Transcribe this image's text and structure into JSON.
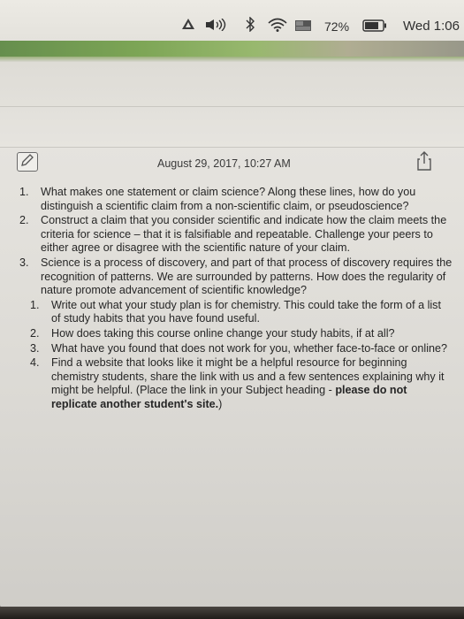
{
  "status_bar": {
    "battery_percent": "72%",
    "clock": "Wed 1:06"
  },
  "note": {
    "timestamp": "August 29, 2017, 10:27 AM",
    "list_a": [
      {
        "num": "1.",
        "text": "What makes one statement or claim science? Along these lines, how do you distinguish a scientific claim from a non-scientific claim, or pseudoscience?"
      },
      {
        "num": "2.",
        "text": "Construct a claim that you consider scientific and indicate how the claim meets the criteria for science – that it is falsifiable and repeatable. Challenge your peers to either agree or disagree with the scientific nature of your claim."
      },
      {
        "num": "3.",
        "text": "Science is a process of discovery, and part of that process of discovery requires the recognition of patterns. We are surrounded by patterns. How does the regularity of nature promote advancement of scientific knowledge?"
      }
    ],
    "list_b": [
      {
        "num": "1.",
        "text": "Write out what your study plan is for chemistry. This could take the form of a list of study habits that you have found useful."
      },
      {
        "num": "2.",
        "text": "How does taking this course online change your study habits, if at all?"
      },
      {
        "num": "3.",
        "text": "What have you found that does not work for you, whether face-to-face or online?"
      },
      {
        "num": "4.",
        "text": "Find a website that looks like it might be a helpful resource for beginning chemistry students, share the link with us and a few sentences explaining why it might be helpful. (Place the link in your Subject heading - ",
        "bold": "please do not replicate another student's site.",
        "tail": ")"
      }
    ]
  }
}
